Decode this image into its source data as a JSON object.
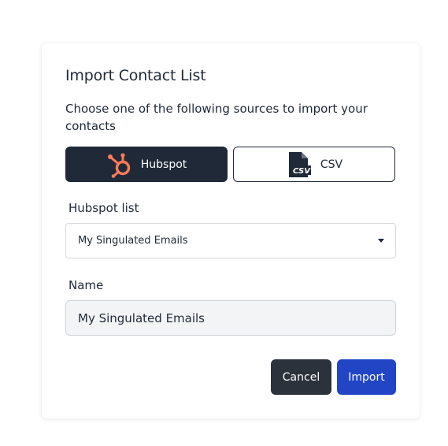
{
  "dialog": {
    "title": "Import Contact List",
    "subtitle": "Choose one of the following sources to import your contacts"
  },
  "sources": {
    "hubspot": {
      "label": "Hubspot",
      "icon": "hubspot-icon",
      "selected": true
    },
    "csv": {
      "label": "CSV",
      "icon": "csv-file-icon",
      "selected": false
    }
  },
  "hubspot_list": {
    "label": "Hubspot list",
    "selected_value": "My Singulated Emails"
  },
  "name_field": {
    "label": "Name",
    "value": "My Singulated Emails"
  },
  "actions": {
    "cancel_label": "Cancel",
    "import_label": "Import"
  },
  "colors": {
    "dark": "#1f2937",
    "primary": "#2145c5",
    "hubspot_orange": "#ff7a59"
  }
}
